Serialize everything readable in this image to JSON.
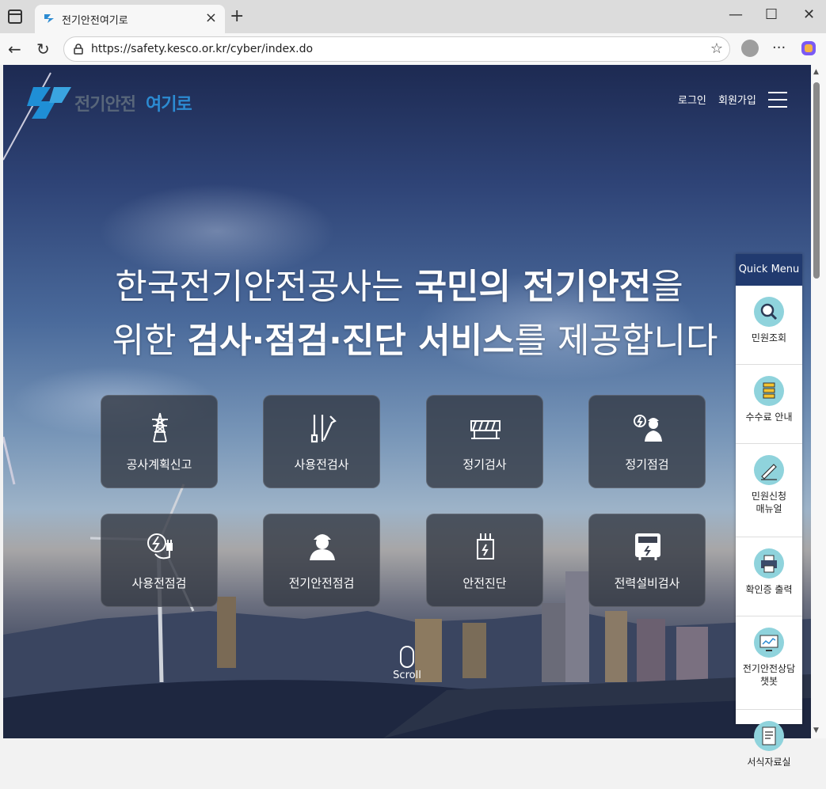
{
  "browser": {
    "tab_title": "전기안전여기로",
    "url": "https://safety.kesco.or.kr/cyber/index.do"
  },
  "site": {
    "logo_part1": "전기안전",
    "logo_part2": "여기로",
    "nav": {
      "login": "로그인",
      "signup": "회원가입"
    },
    "headline": {
      "line1_normal": "한국전기안전공사는 ",
      "line1_bold": "국민의 전기안전",
      "line1_tail": "을",
      "line2_normal": "위한 ",
      "line2_bold": "검사·점검·진단 서비스",
      "line2_tail": "를 제공합니다"
    },
    "services": [
      {
        "label": "공사계획신고",
        "icon": "tower-icon"
      },
      {
        "label": "사용전검사",
        "icon": "tools-icon"
      },
      {
        "label": "정기검사",
        "icon": "barrier-icon"
      },
      {
        "label": "정기점검",
        "icon": "worker-bolt-icon"
      },
      {
        "label": "사용전점검",
        "icon": "plug-bolt-icon"
      },
      {
        "label": "전기안전점검",
        "icon": "worker-icon"
      },
      {
        "label": "안전진단",
        "icon": "transformer-icon"
      },
      {
        "label": "전력설비검사",
        "icon": "meter-icon"
      }
    ],
    "scroll_label": "Scroll",
    "quick_menu": {
      "title": "Quick Menu",
      "items": [
        {
          "label": "민원조회"
        },
        {
          "label": "수수료 안내"
        },
        {
          "label": "민원신청\n매뉴얼"
        },
        {
          "label": "확인증 출력"
        },
        {
          "label": "전기안전상담\n챗봇"
        },
        {
          "label": "서식자료실"
        }
      ]
    }
  }
}
